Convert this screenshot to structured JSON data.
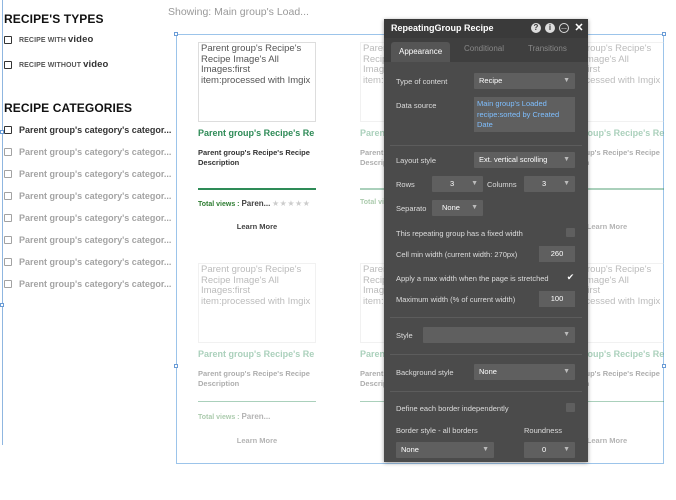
{
  "status_text": "Showing: Main group's Load...",
  "sidebar": {
    "types_title": "RECIPE'S TYPES",
    "types": [
      {
        "prefix": "RECIPE WITH ",
        "word": "video"
      },
      {
        "prefix": "RECIPE WITHOUT ",
        "word": "video"
      }
    ],
    "categories_title": "RECIPE CATEGORIES",
    "category_label": "Parent group's category's categor..."
  },
  "cell": {
    "image_text": "Parent group's Recipe's Recipe Image's All Images:first item:processed with Imgix",
    "title": "Parent group's Recipe's Re",
    "description": "Parent group's Recipe's Recipe Description",
    "views_label": "Total views : ",
    "views_value": "Paren...",
    "stars": "★★★★★",
    "learn_more": "Learn More"
  },
  "editor": {
    "title": "RepeatingGroup Recipe",
    "icons": [
      "question-icon",
      "info-icon",
      "comment-icon",
      "close-icon"
    ],
    "tabs": [
      "Appearance",
      "Conditional",
      "Transitions"
    ],
    "type_of_content_label": "Type of content",
    "type_of_content_value": "Recipe",
    "data_source_label": "Data source",
    "data_source_value": "Main group's Loaded recipe:sorted by Created Date",
    "layout_style_label": "Layout style",
    "layout_style_value": "Ext. vertical scrolling",
    "rows_label": "Rows",
    "rows_value": "3",
    "columns_label": "Columns",
    "columns_value": "3",
    "separator_label": "Separato",
    "separator_value": "None",
    "fixed_width_label": "This repeating group has a fixed width",
    "cell_min_width_label": "Cell min width (current width: 270px)",
    "cell_min_width_value": "260",
    "max_width_label": "Apply a max width when the page is stretched",
    "max_width_checked": "✔",
    "maximum_width_label": "Maximum width (% of current width)",
    "maximum_width_value": "100",
    "style_label": "Style",
    "style_value": "",
    "background_style_label": "Background style",
    "background_style_value": "None",
    "border_independent_label": "Define each border independently",
    "border_style_label": "Border style - all borders",
    "roundness_label": "Roundness",
    "border_style_value": "None",
    "roundness_value": "0"
  },
  "colors": {
    "accent_green": "#2e8b57",
    "editor_bg": "#4b4b4b",
    "link_blue": "#7fbfff",
    "selection_blue": "#9cc4ea"
  }
}
